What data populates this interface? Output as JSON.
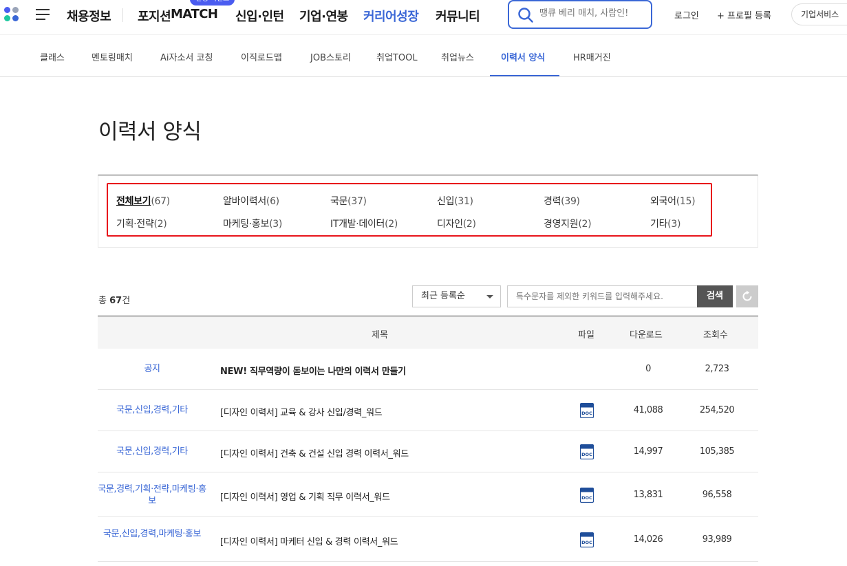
{
  "header": {
    "nav": [
      "채용정보",
      "포지션",
      "MATCH",
      "신입·인턴",
      "기업·연봉",
      "커리어성장",
      "커뮤니티"
    ],
    "match_badge": "진행 이벤트",
    "search_placeholder": "땡큐 베리 매치, 사람인!",
    "login": "로그인",
    "profile_register": "+ 프로필 등록",
    "corp_service": "기업서비스"
  },
  "subnav": {
    "items": [
      "클래스",
      "멘토링매치",
      "Ai자소서 코칭",
      "이직로드맵",
      "JOB스토리",
      "취업TOOL",
      "취업뉴스",
      "이력서 양식",
      "HR매거진"
    ],
    "active": "이력서 양식"
  },
  "page": {
    "title": "이력서 양식"
  },
  "categories": [
    {
      "name": "전체보기",
      "count": "(67)"
    },
    {
      "name": "알바이력서",
      "count": "(6)"
    },
    {
      "name": "국문",
      "count": "(37)"
    },
    {
      "name": "신입",
      "count": "(31)"
    },
    {
      "name": "경력",
      "count": "(39)"
    },
    {
      "name": "외국어",
      "count": "(15)"
    },
    {
      "name": "기획·전략",
      "count": "(2)"
    },
    {
      "name": "마케팅·홍보",
      "count": "(3)"
    },
    {
      "name": "IT개발·데이터",
      "count": "(2)"
    },
    {
      "name": "디자인",
      "count": "(2)"
    },
    {
      "name": "경영지원",
      "count": "(2)"
    },
    {
      "name": "기타",
      "count": "(3)"
    }
  ],
  "list": {
    "total_prefix": "총 ",
    "total_count": "67",
    "total_suffix": "건",
    "sort": "최근 등록순",
    "keyword_placeholder": "특수문자를 제외한 키워드를 입력해주세요.",
    "search_button": "검색"
  },
  "table": {
    "headers": {
      "title": "제목",
      "file": "파일",
      "download": "다운로드",
      "views": "조회수"
    },
    "rows": [
      {
        "category": "공지",
        "title": "NEW! 직무역량이 돋보이는 나만의 이력서 만들기",
        "download": "0",
        "views": "2,723",
        "notice": true
      },
      {
        "category": "국문,신입,경력,기타",
        "title": "[디자인 이력서] 교육 & 강사 신입/경력_워드",
        "download": "41,088",
        "views": "254,520"
      },
      {
        "category": "국문,신입,경력,기타",
        "title": "[디자인 이력서] 건축 & 건설 신입 경력 이력서_워드",
        "download": "14,997",
        "views": "105,385"
      },
      {
        "category": "국문,경력,기획·전략,마케팅·홍보",
        "title": "[디자인 이력서] 영업 & 기획 직무 이력서_워드",
        "download": "13,831",
        "views": "96,558"
      },
      {
        "category": "국문,신입,경력,마케팅·홍보",
        "title": "[디자인 이력서] 마케터 신입 & 경력 이력서_워드",
        "download": "14,026",
        "views": "93,989"
      }
    ],
    "file_icon": "doc-icon"
  },
  "colors": {
    "accent": "#3a67d6",
    "highlight": "#e8141b"
  }
}
